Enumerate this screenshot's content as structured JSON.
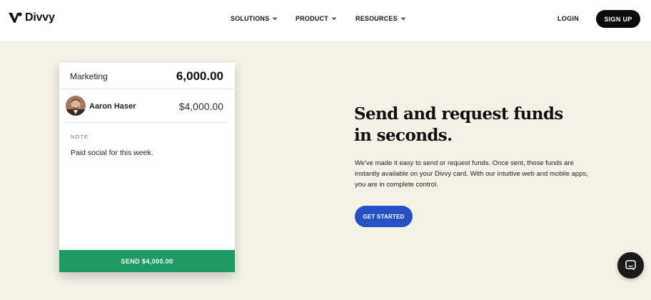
{
  "header": {
    "brand": "Divvy",
    "nav": [
      {
        "label": "SOLUTIONS"
      },
      {
        "label": "PRODUCT"
      },
      {
        "label": "RESOURCES"
      }
    ],
    "login_label": "LOGIN",
    "signup_label": "SIGN UP"
  },
  "card": {
    "category": "Marketing",
    "budget": "6,000.00",
    "user_name": "Aaron Haser",
    "user_amount": "$4,000.00",
    "note_label": "NOTE",
    "note_text": "Paid social for this week.",
    "send_label": "SEND $4,000.00",
    "send_color": "#1c9b63"
  },
  "hero": {
    "headline": "Send and request funds in seconds.",
    "description": "We've made it easy to send or request funds. Once sent, those funds are instantly available on your Divvy card. With our intuitive web and mobile apps, you are in complete control.",
    "cta_label": "GET STARTED",
    "cta_color": "#2451c4"
  },
  "icons": {
    "nav_dropdown": "chevron-down-icon",
    "chat": "chat-bubble-icon",
    "logo": "divvy-logo-icon"
  },
  "colors": {
    "hero_background": "#f4f1e7",
    "header_background": "#ffffff",
    "signup_background": "#0b0b0b"
  }
}
